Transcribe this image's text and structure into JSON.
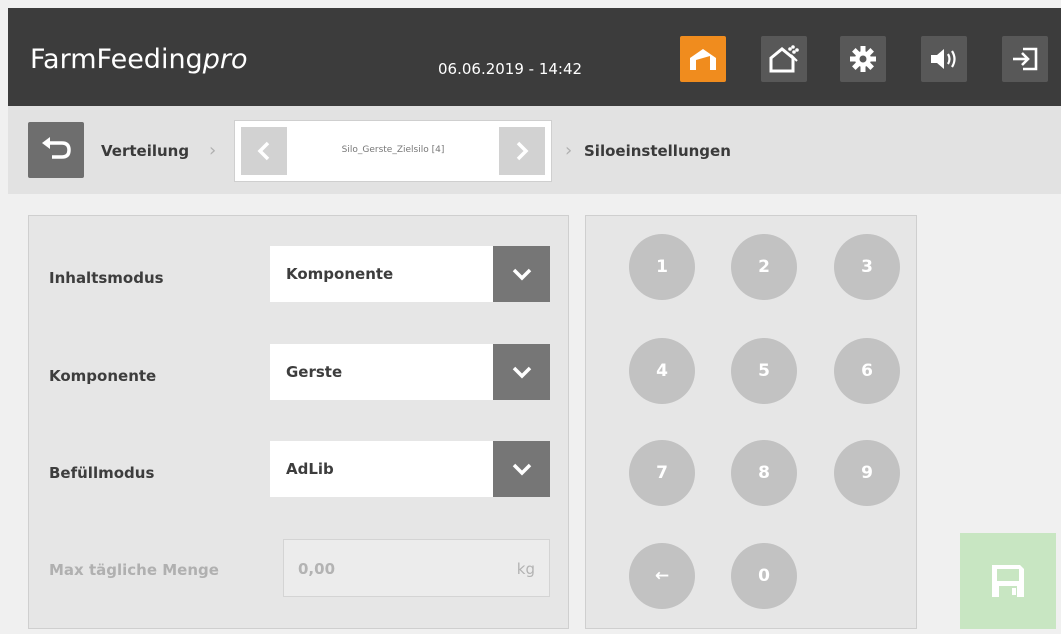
{
  "header": {
    "brand_main": "FarmFeeding",
    "brand_pro": "pro",
    "datetime": "06.06.2019 - 14:42",
    "buttons": [
      {
        "icon": "home-icon",
        "active": true
      },
      {
        "icon": "barn-grain-icon",
        "active": false
      },
      {
        "icon": "gear-icon",
        "active": false
      },
      {
        "icon": "speaker-icon",
        "active": false
      },
      {
        "icon": "logout-icon",
        "active": false
      }
    ],
    "accent_color": "#f08c1e"
  },
  "breadcrumb": {
    "back_icon": "back-arrow-icon",
    "item1": "Verteilung",
    "selector_value": "Silo_Gerste_Zielsilo [4]",
    "item3": "Siloeinstellungen"
  },
  "form": {
    "inhaltsmodus": {
      "label": "Inhaltsmodus",
      "value": "Komponente"
    },
    "komponente": {
      "label": "Komponente",
      "value": "Gerste"
    },
    "befuellmodus": {
      "label": "Befüllmodus",
      "value": "AdLib"
    },
    "max_menge": {
      "label": "Max tägliche Menge",
      "value": "0,00",
      "unit": "kg",
      "disabled": true
    }
  },
  "keypad": {
    "keys": [
      "1",
      "2",
      "3",
      "4",
      "5",
      "6",
      "7",
      "8",
      "9",
      "←",
      "0"
    ]
  },
  "save": {
    "icon": "save-icon",
    "color": "#c8e6c2"
  }
}
